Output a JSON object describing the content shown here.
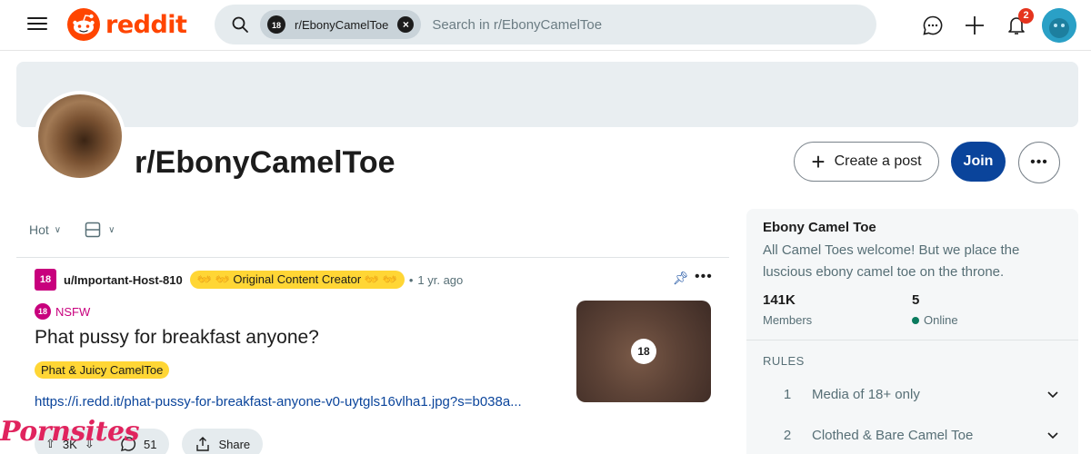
{
  "header": {
    "logo_text": "reddit",
    "search_chip_label": "r/EbonyCamelToe",
    "search_chip_badge": "18",
    "search_placeholder": "Search in r/EbonyCamelToe",
    "notification_count": "2"
  },
  "subreddit": {
    "name": "r/EbonyCamelToe",
    "create_post_label": "Create a post",
    "join_label": "Join",
    "more_label": "•••"
  },
  "feed": {
    "sort_label": "Hot"
  },
  "post": {
    "user_badge": "18",
    "username": "u/Important-Host-810",
    "user_flair": "👐 👐 Original Content Creator 👐 👐",
    "time_ago": "1 yr. ago",
    "nsfw_badge": "18",
    "nsfw_label": "NSFW",
    "title": "Phat pussy for breakfast anyone?",
    "flair": "Phat & Juicy CamelToe",
    "link": "https://i.redd.it/phat-pussy-for-breakfast-anyone-v0-uytgls16vlha1.jpg?s=b038a...",
    "thumb_badge": "18",
    "votes": "3K",
    "comments": "51",
    "share_label": "Share"
  },
  "watermark": "Pornsites",
  "sidebar": {
    "title": "Ebony Camel Toe",
    "description": "All Camel Toes welcome! But we place the luscious ebony camel toe on the throne.",
    "members_value": "141K",
    "members_label": "Members",
    "online_value": "5",
    "online_label": "Online",
    "rules_header": "RULES",
    "rules": [
      {
        "num": "1",
        "text": "Media of 18+ only"
      },
      {
        "num": "2",
        "text": "Clothed & Bare Camel Toe"
      }
    ]
  },
  "colors": {
    "brand": "#ff4500",
    "join": "#0a449b",
    "nsfw": "#c8007d",
    "flair": "#ffd635",
    "online": "#0a7b5e"
  }
}
